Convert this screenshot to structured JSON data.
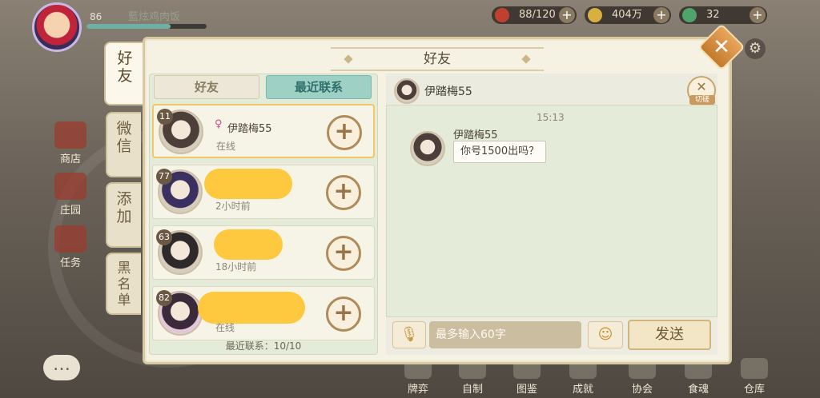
{
  "header": {
    "level": "86",
    "player_name": "藍炫鸡肉饭",
    "resources": [
      {
        "label": "88/120",
        "icon": "stamina-icon",
        "color": "#c0402f"
      },
      {
        "label": "404万",
        "icon": "gold-coin-icon",
        "color": "#d8b040"
      },
      {
        "label": "32",
        "icon": "jade-icon",
        "color": "#4fa36b"
      }
    ]
  },
  "side_icons": [
    {
      "label": "商店",
      "icon": "shop-icon"
    },
    {
      "label": "庄园",
      "icon": "manor-icon"
    },
    {
      "label": "任务",
      "icon": "task-icon"
    }
  ],
  "bottom_nav": [
    "牌弈",
    "自制",
    "图鉴",
    "成就",
    "协会",
    "食魂",
    "仓库"
  ],
  "modal": {
    "title": "好友",
    "vertical_tabs": [
      "好友",
      "微信",
      "添加",
      "黑名单"
    ],
    "sub_tabs": {
      "friends": "好友",
      "recent": "最近联系"
    },
    "friends": [
      {
        "level": "11",
        "name": "伊踏梅55",
        "status": "在线",
        "sex": "♀",
        "selected": true
      },
      {
        "level": "77",
        "name": "",
        "status": "2小时前",
        "sex": "",
        "selected": false
      },
      {
        "level": "63",
        "name": "",
        "status": "18小时前",
        "sex": "",
        "selected": false
      },
      {
        "level": "82",
        "name": "",
        "status": "在线",
        "sex": "",
        "selected": false
      }
    ],
    "add_symbol": "+",
    "recent_count": "最近联系：10/10",
    "chat": {
      "header_name": "伊踏梅55",
      "switch_label": "切磋",
      "time": "15:13",
      "message_sender": "伊踏梅55",
      "message_text": "你号1500出吗？",
      "input_placeholder": "最多输入60字",
      "send_label": "发送"
    }
  }
}
